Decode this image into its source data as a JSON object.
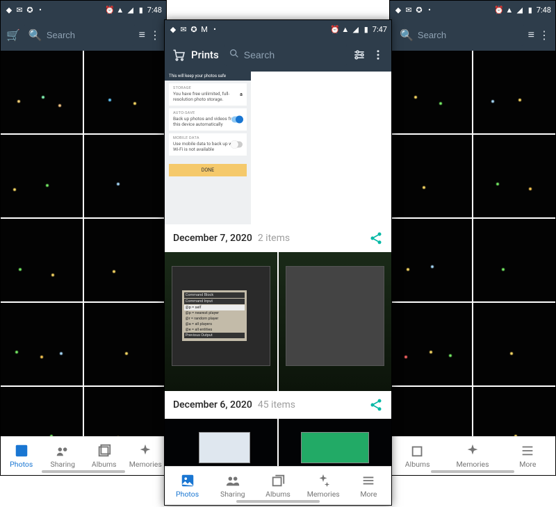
{
  "status": {
    "time_side": "7:48",
    "time_center": "7:47"
  },
  "topbar": {
    "prints_label": "Prints",
    "search_placeholder": "Search"
  },
  "settings": {
    "header": "This will keep your photos safe",
    "storage_label": "STORAGE",
    "storage_text": "You have free unlimited, full-resolution photo storage.",
    "autosave_label": "AUTO-SAVE",
    "autosave_text": "Back up photos and videos from this device automatically",
    "mobiledata_label": "MOBILE DATA",
    "mobiledata_text": "Use mobile data to back up when Wi-Fi is not available",
    "done": "DONE"
  },
  "sections": [
    {
      "date": "December 7, 2020",
      "count": "2 items"
    },
    {
      "date": "December 6, 2020",
      "count": "45 items"
    }
  ],
  "minecraft": {
    "title": "Command Block",
    "input_label": "Command Input",
    "lines": [
      "@p = self",
      "@p = nearest player",
      "@r = random player",
      "@a = all players",
      "@e = all entities"
    ],
    "output_label": "Previous Output"
  },
  "nav": {
    "photos": "Photos",
    "sharing": "Sharing",
    "albums": "Albums",
    "memories": "Memories",
    "more": "More"
  },
  "colors": {
    "header_bg": "#2e3d4b",
    "active": "#1976d2",
    "share": "#00b8a5"
  }
}
